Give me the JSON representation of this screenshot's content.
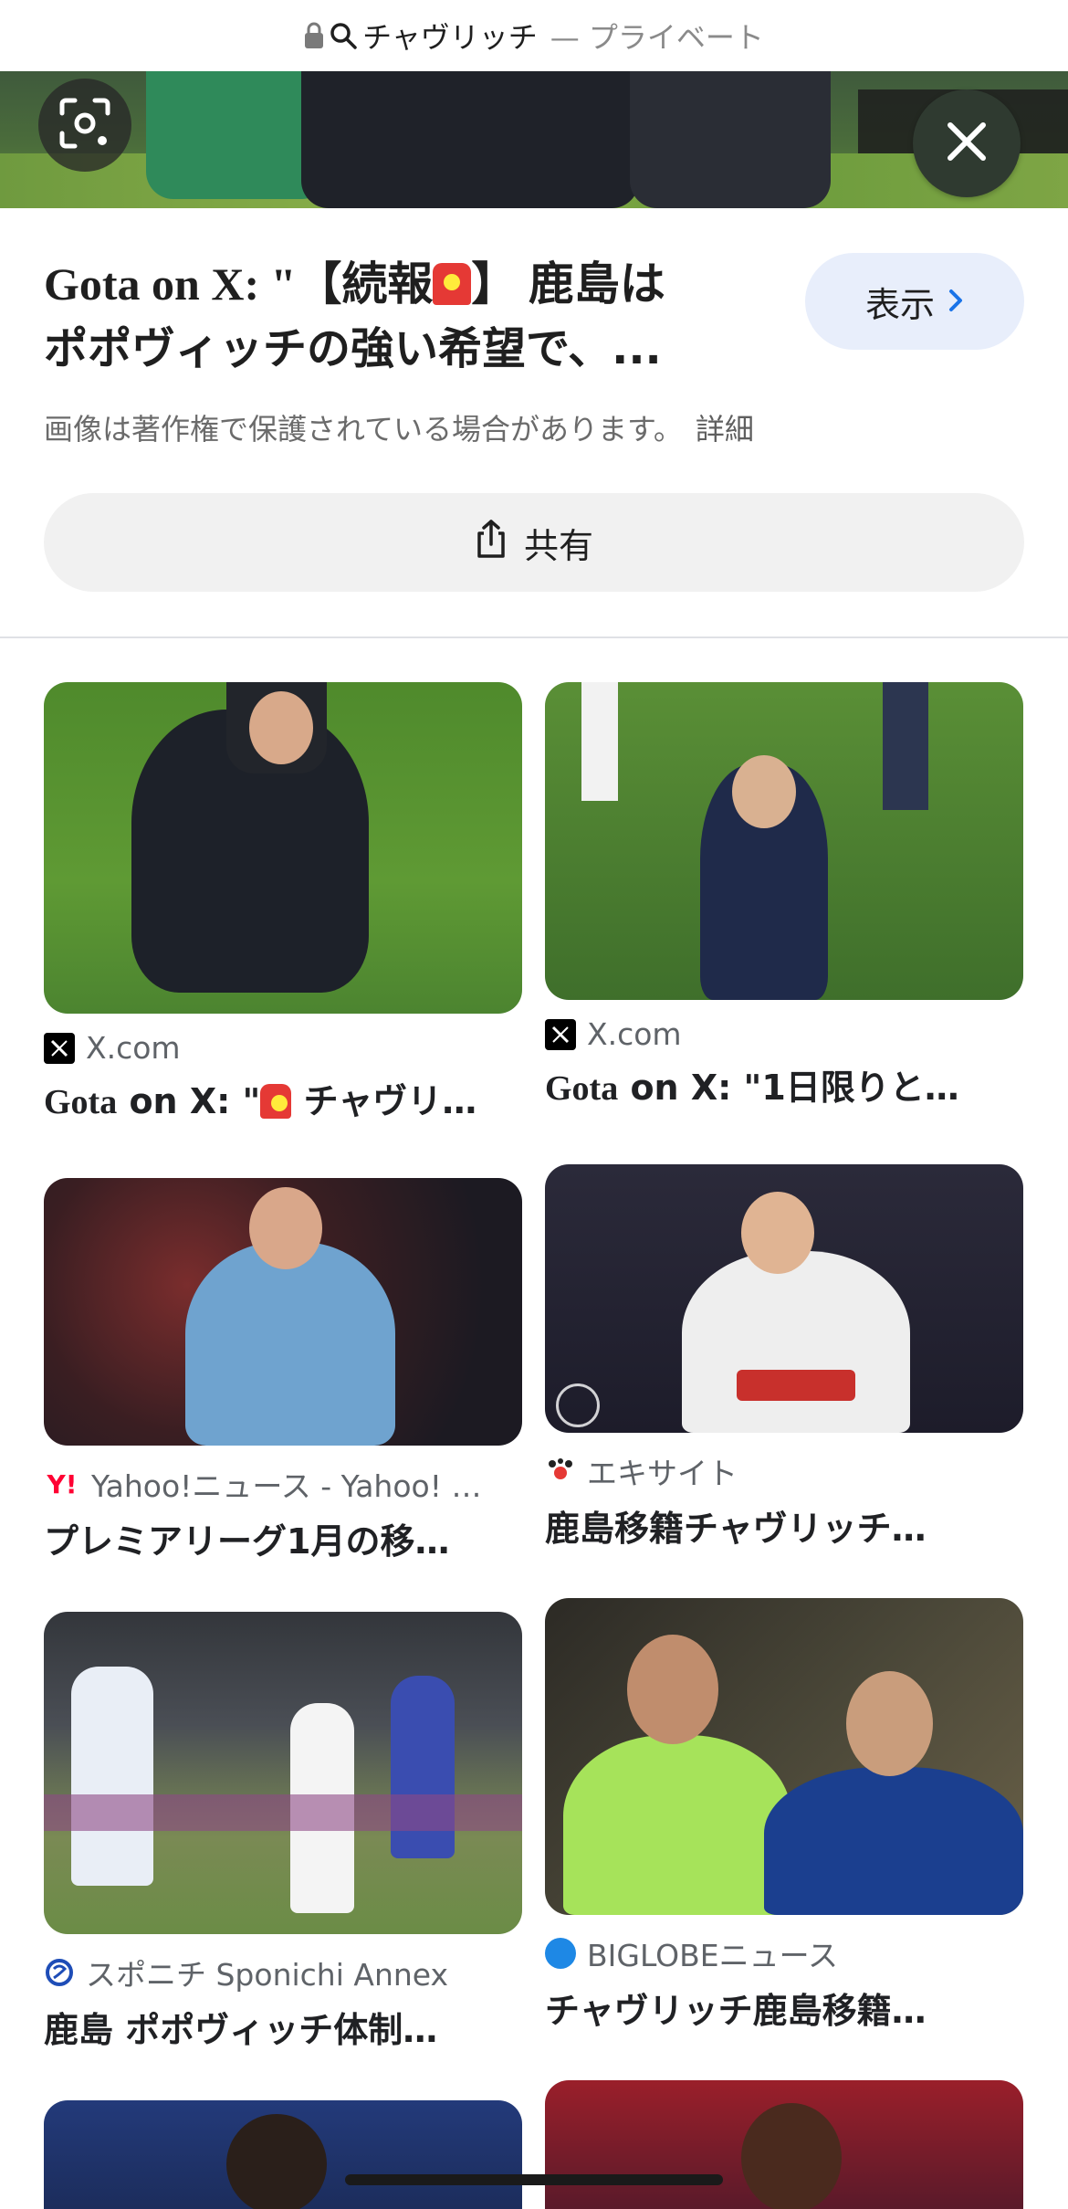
{
  "topbar": {
    "query": "チャヴリッチ",
    "mode": "— プライベート"
  },
  "hero": {
    "close_label": "×"
  },
  "info": {
    "title_line1_a": "Gota on X: \"【続報",
    "title_line1_b": "】 鹿島は",
    "title_line2": "ポポヴィッチの強い希望で、...",
    "view_button": "表示",
    "copyright": "画像は著作権で保護されている場合があります。",
    "copyright_link": "詳細",
    "share_button": "共有"
  },
  "results": [
    {
      "source": "X.com",
      "caption_a": "Gota",
      "caption_b": " on X: \"",
      "caption_c": " チャヴリ…"
    },
    {
      "source": "X.com",
      "caption_a": "Gota",
      "caption_b": " on X: \"1日限りと…"
    },
    {
      "source": "Yahoo!ニュース - Yahoo! …",
      "caption": "プレミアリーグ1月の移…"
    },
    {
      "source": "エキサイト",
      "caption": "鹿島移籍チャヴリッチ…"
    },
    {
      "source": "スポニチ Sponichi Annex",
      "caption": "鹿島 ポポヴィッチ体制…"
    },
    {
      "source": "BIGLOBEニュース",
      "caption": "チャヴリッチ鹿島移籍…"
    }
  ],
  "icons": {
    "lock": "lock-icon",
    "search": "search-icon",
    "lens": "lens-icon",
    "close": "close-icon",
    "chevron": "chevron-right-icon",
    "share": "share-icon"
  },
  "colors": {
    "view_button_bg": "#e8eefb",
    "share_button_bg": "#f1f1f1",
    "chevron": "#1a73e8"
  }
}
